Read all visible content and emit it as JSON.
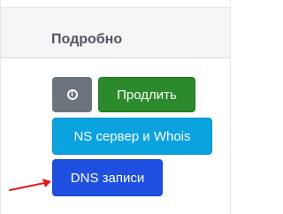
{
  "header": {
    "title": "Подробно"
  },
  "buttons": {
    "info_icon": "info-circle-icon",
    "info_glyph": "i",
    "renew_label": "Продлить",
    "ns_whois_label": "NS сервер и Whois",
    "dns_label": "DNS записи"
  },
  "colors": {
    "info_button": "#6c757d",
    "renew_button": "#2b8a2b",
    "ns_button": "#0aa3e0",
    "dns_button": "#1f4fe0",
    "annotation_arrow": "#e01b1b"
  }
}
